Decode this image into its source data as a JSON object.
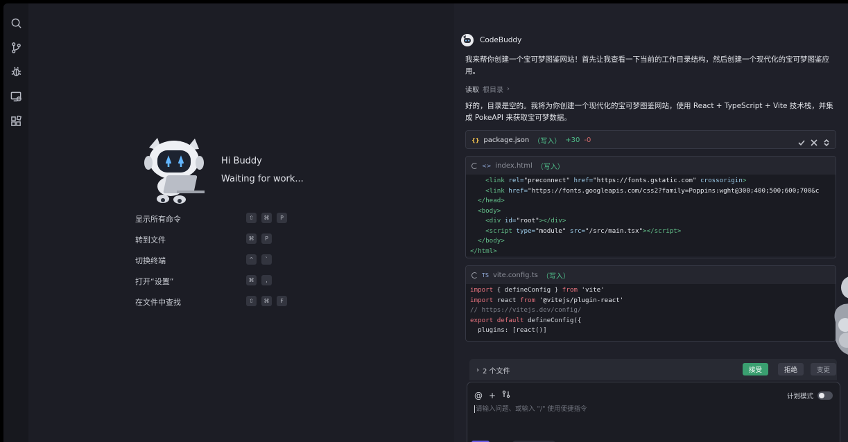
{
  "activity_bar": {
    "icons": [
      "search-icon",
      "source-control-icon",
      "debug-icon",
      "remote-explorer-icon",
      "extensions-icon"
    ]
  },
  "welcome": {
    "greeting": "Hi Buddy",
    "status": "Waiting for work...",
    "commands": [
      {
        "label": "显示所有命令",
        "keys": [
          "⇧",
          "⌘",
          "P"
        ]
      },
      {
        "label": "转到文件",
        "keys": [
          "⌘",
          "P"
        ]
      },
      {
        "label": "切换终端",
        "keys": [
          "^",
          "`"
        ]
      },
      {
        "label": "打开“设置”",
        "keys": [
          "⌘",
          ","
        ]
      },
      {
        "label": "在文件中查找",
        "keys": [
          "⇧",
          "⌘",
          "F"
        ]
      }
    ]
  },
  "chat": {
    "bot_name": "CodeBuddy",
    "intro": "我来帮你创建一个宝可梦图鉴网站！首先让我查看一下当前的工作目录结构，然后创建一个现代化的宝可梦图鉴应用。",
    "read_action": "读取",
    "read_target": "根目录",
    "plan_text": "好的，目录是空的。我将为你创建一个现代化的宝可梦图鉴网站，使用 React + TypeScript + Vite 技术栈，并集成 PokeAPI 来获取宝可梦数据。",
    "files": [
      {
        "icon": "{}",
        "name": "package.json",
        "tag": "（写入）",
        "added": "+30",
        "removed": "-0"
      },
      {
        "icon": "<>",
        "name": "index.html",
        "tag": "（写入）"
      },
      {
        "icon": "TS",
        "name": "vite.config.ts",
        "tag": "（写入）"
      }
    ],
    "changes_count": "2 个文件",
    "accept_label": "接受",
    "reject_label": "拒绝",
    "change_label": "变更",
    "plan_mode_label": "计划模式",
    "input_placeholder": "请输入问题、或输入 \"/\" 使用便捷指令"
  }
}
